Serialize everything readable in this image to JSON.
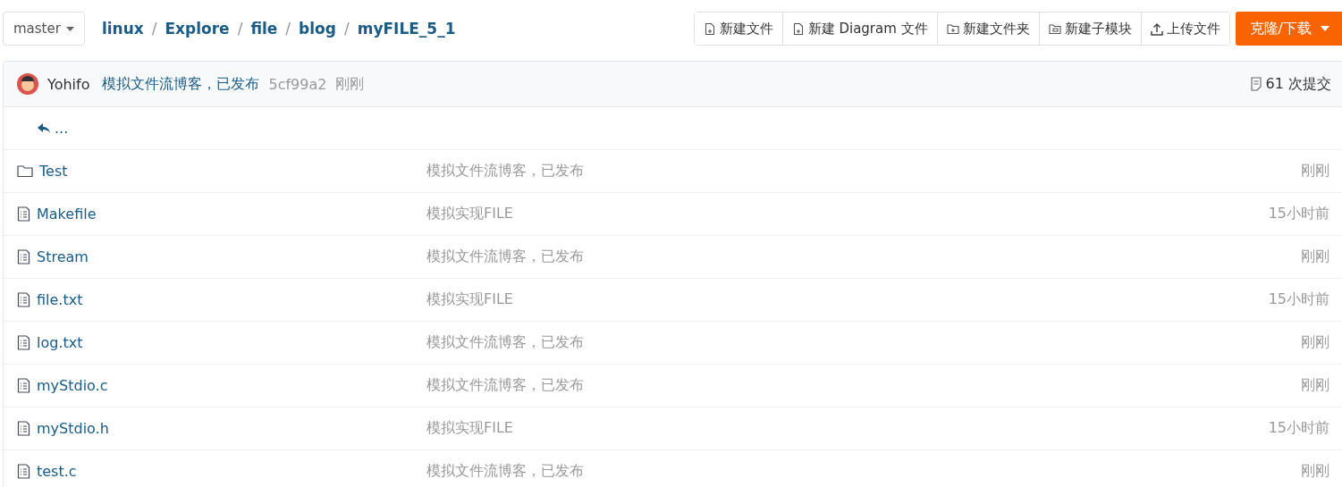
{
  "branch": {
    "label": "master"
  },
  "breadcrumb": [
    {
      "label": "linux",
      "separator": "/"
    },
    {
      "label": "Explore",
      "separator": "/"
    },
    {
      "label": "file",
      "separator": "/"
    },
    {
      "label": "blog",
      "separator": "/"
    },
    {
      "label": "myFILE_5_1"
    }
  ],
  "actions": [
    {
      "kind": "file",
      "label": "新建文件"
    },
    {
      "kind": "file",
      "label": "新建 Diagram 文件"
    },
    {
      "kind": "folder",
      "label": "新建文件夹"
    },
    {
      "kind": "submodule",
      "label": "新建子模块"
    },
    {
      "kind": "upload",
      "label": "上传文件"
    }
  ],
  "clone_button": {
    "label": "克隆/下载"
  },
  "last_commit": {
    "author": "Yohifo",
    "message": "模拟文件流博客，已发布",
    "hash": "5cf99a2",
    "time": "刚刚",
    "commit_count": "61 次提交"
  },
  "parent_link": {
    "label": "..."
  },
  "files": [
    {
      "kind": "folder",
      "name": "Test",
      "message": "模拟文件流博客，已发布",
      "time": "刚刚"
    },
    {
      "kind": "file",
      "name": "Makefile",
      "message": "模拟实现FILE",
      "time": "15小时前"
    },
    {
      "kind": "file",
      "name": "Stream",
      "message": "模拟文件流博客，已发布",
      "time": "刚刚"
    },
    {
      "kind": "file",
      "name": "file.txt",
      "message": "模拟实现FILE",
      "time": "15小时前"
    },
    {
      "kind": "file",
      "name": "log.txt",
      "message": "模拟文件流博客，已发布",
      "time": "刚刚"
    },
    {
      "kind": "file",
      "name": "myStdio.c",
      "message": "模拟文件流博客，已发布",
      "time": "刚刚"
    },
    {
      "kind": "file",
      "name": "myStdio.h",
      "message": "模拟实现FILE",
      "time": "15小时前"
    },
    {
      "kind": "file",
      "name": "test.c",
      "message": "模拟文件流博客，已发布",
      "time": "刚刚"
    }
  ]
}
